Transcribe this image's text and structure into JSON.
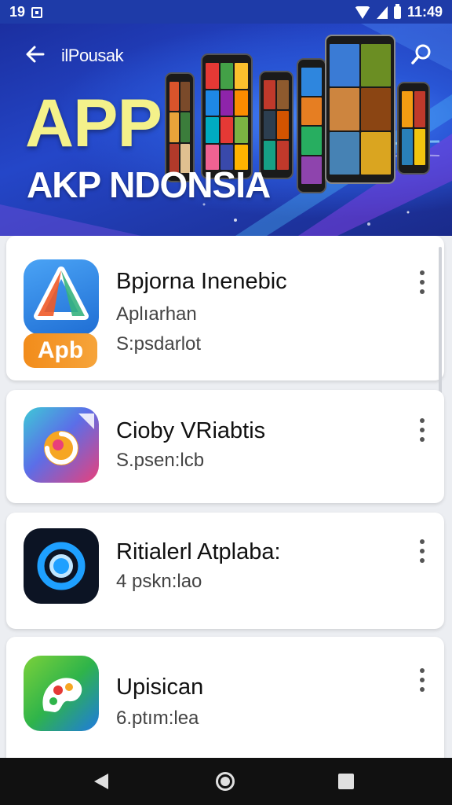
{
  "status_bar": {
    "left_text": "19",
    "time": "11:49"
  },
  "header": {
    "brand": "ilPousak",
    "title": "APP",
    "subtitle": "AKP NDONSIA"
  },
  "apps": [
    {
      "name": "Bpjorna Inenebic",
      "line1": "Aplıarhan",
      "line2": "S:psdarlot",
      "badge": "Apb"
    },
    {
      "name": "Cioby VRiabtis",
      "line1": "S.psen:lcb"
    },
    {
      "name": "Ritialerl Atplaba:",
      "line1": "4 pskn:lao"
    },
    {
      "name": "Upisican",
      "line1": "6.ptım:lea"
    }
  ],
  "colors": {
    "hero_blue": "#2446c8",
    "title_yellow": "#f4f18a",
    "nav_dark": "#111111"
  }
}
